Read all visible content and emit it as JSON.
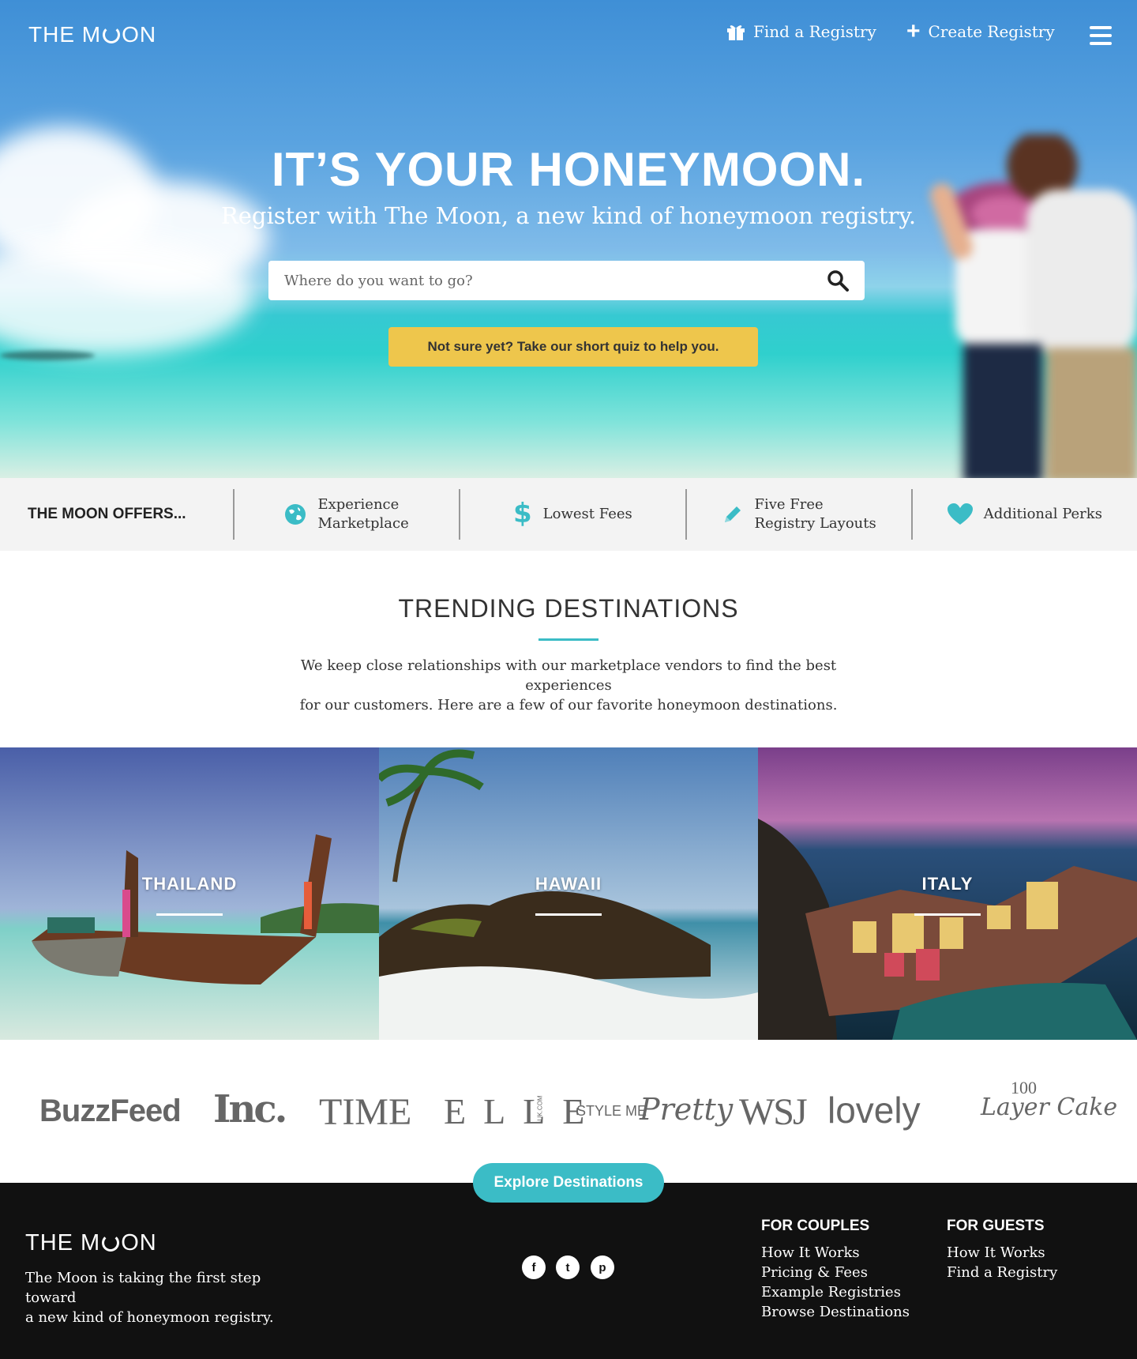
{
  "brand": {
    "logo_left": "THE M",
    "logo_right": "ON"
  },
  "nav": {
    "find_registry": "Find a Registry",
    "create_registry": "Create Registry"
  },
  "hero": {
    "title": "IT’S YOUR HONEYMOON.",
    "subtitle": "Register with The Moon, a new kind of honeymoon registry.",
    "search_placeholder": "Where do you want to go?",
    "quiz_button": "Not sure yet? Take our short quiz to help you."
  },
  "offers": {
    "title": "THE MOON OFFERS...",
    "items": [
      {
        "icon": "globe-icon",
        "line1": "Experience",
        "line2": "Marketplace"
      },
      {
        "icon": "dollar-icon",
        "line1": "Lowest Fees",
        "line2": ""
      },
      {
        "icon": "pencil-icon",
        "line1": "Five Free",
        "line2": "Registry Layouts"
      },
      {
        "icon": "heart-icon",
        "line1": "Additional Perks",
        "line2": ""
      }
    ]
  },
  "trending": {
    "title": "TRENDING DESTINATIONS",
    "desc_line1": "We keep close relationships with our marketplace vendors to find the best experiences",
    "desc_line2": "for our customers. Here are a few of our favorite honeymoon destinations.",
    "destinations": [
      "THAILAND",
      "HAWAII",
      "ITALY"
    ]
  },
  "press": {
    "logos": [
      "BuzzFeed",
      "Inc.",
      "TIME",
      "ELLE",
      "UK.COM",
      "STYLE ME",
      "Pretty",
      "WSJ",
      "lovely",
      "100",
      "Layer Cake"
    ]
  },
  "explore_button": "Explore Destinations",
  "footer": {
    "logo_left": "THE M",
    "logo_right": "ON",
    "tagline_line1": "The Moon is taking the first step toward",
    "tagline_line2": "a new kind of honeymoon registry.",
    "social": [
      "f",
      "t",
      "p"
    ],
    "couples": {
      "heading": "FOR COUPLES",
      "links": [
        "How It Works",
        "Pricing & Fees",
        "Example Registries",
        "Browse Destinations"
      ]
    },
    "guests": {
      "heading": "FOR GUESTS",
      "links": [
        "How It Works",
        "Find a Registry"
      ]
    }
  },
  "colors": {
    "accent": "#3bbcc6",
    "quiz": "#eec64c",
    "footer": "#111111"
  }
}
